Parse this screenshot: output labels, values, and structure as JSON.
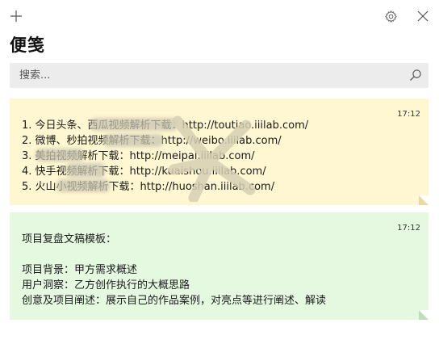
{
  "app": {
    "title": "便笺"
  },
  "toolbar": {
    "add_icon": "plus-icon",
    "settings_icon": "gear-icon",
    "close_icon": "close-icon"
  },
  "search": {
    "placeholder": "搜索...",
    "value": "",
    "icon": "search-icon"
  },
  "notes": [
    {
      "time": "17:12",
      "color": "#fff7d1",
      "lines": [
        "1. 今日头条、西瓜视频解析下载：http://toutiao.iiilab.com/",
        "2. 微博、秒拍视频解析下载：http://weibo.iiilab.com/",
        "3. 美拍视频解析下载：http://meipai.iiilab.com/",
        "4. 快手视频解析下载：http://kuaishou.iiilab.com/",
        "5. 火山小视频解析下载：http://huoshan.iiilab.com/"
      ]
    },
    {
      "time": "17:12",
      "color": "#e4f9e0",
      "lines": [
        "项目复盘文稿模板：",
        "",
        "项目背景：甲方需求概述",
        "用户洞察：乙方创作执行的大概思路",
        "创意及项目阐述：展示自己的作品案例，对亮点等进行阐述、解读"
      ]
    }
  ]
}
